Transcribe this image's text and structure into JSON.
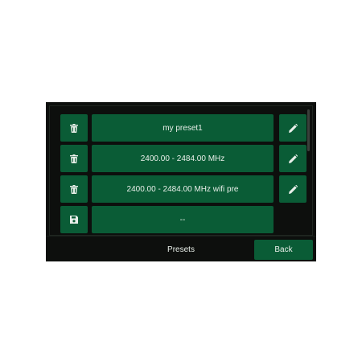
{
  "presets": {
    "items": [
      {
        "label": "my preset1",
        "left_icon": "trash-icon",
        "right_icon": "pencil-icon"
      },
      {
        "label": "2400.00 - 2484.00 MHz",
        "left_icon": "trash-icon",
        "right_icon": "pencil-icon"
      },
      {
        "label": "2400.00 - 2484.00 MHz wifi pre",
        "left_icon": "trash-icon",
        "right_icon": "pencil-icon"
      },
      {
        "label": "--",
        "left_icon": "save-icon",
        "right_icon": ""
      }
    ]
  },
  "footer": {
    "title": "Presets",
    "back_label": "Back"
  },
  "colors": {
    "button": "#0a5c36",
    "background": "#0d0f0d",
    "text": "#e8efe9"
  }
}
